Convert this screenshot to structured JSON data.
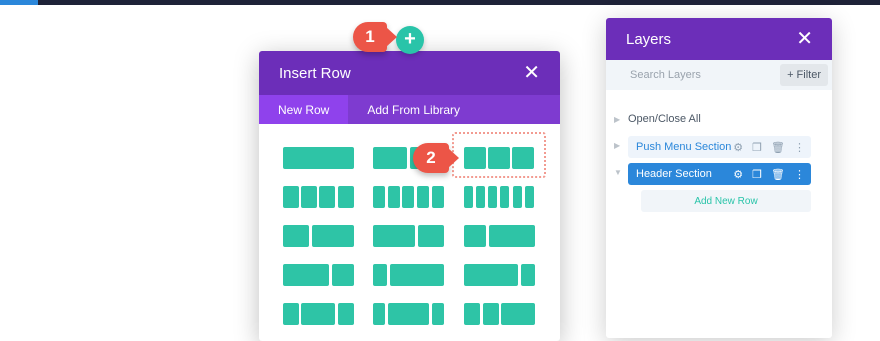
{
  "callouts": [
    "1",
    "2"
  ],
  "add_button": {
    "label": "+"
  },
  "insert_row": {
    "title": "Insert Row",
    "close": "✕",
    "tabs": [
      "New Row",
      "Add From Library"
    ]
  },
  "layers": {
    "title": "Layers",
    "close": "✕",
    "search_placeholder": "Search Layers",
    "filter_label": "+ Filter",
    "open_close_all": "Open/Close All",
    "sections": [
      "Push Menu Section",
      "Header Section"
    ],
    "add_new_row": "Add New Row"
  },
  "colors": {
    "purple": "#6c2eb9",
    "tab_active": "#8f42ec",
    "teal": "#2ec4a6",
    "blue": "#2b87da",
    "callout": "#ec5547"
  }
}
